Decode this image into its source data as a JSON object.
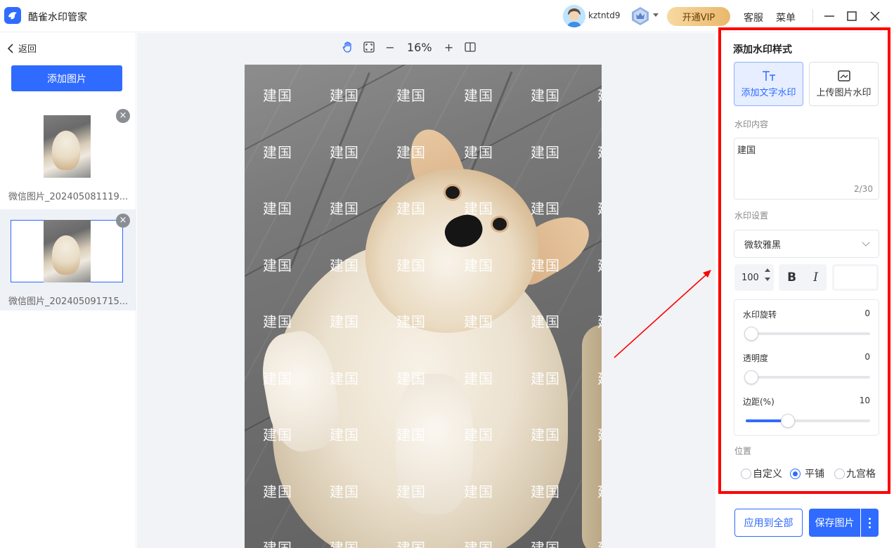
{
  "app": {
    "title": "酷雀水印管家"
  },
  "user": {
    "name": "kztntd9"
  },
  "topbar": {
    "vip_label": "开通VIP",
    "service_label": "客服",
    "menu_label": "菜单"
  },
  "sidebar": {
    "back_label": "返回",
    "add_image_label": "添加图片",
    "images": [
      {
        "name": "微信图片_202405081119...",
        "active": false
      },
      {
        "name": "微信图片_202405091715...",
        "active": true
      }
    ]
  },
  "toolbar": {
    "zoom": "16%",
    "zoom_out": "−",
    "zoom_in": "+"
  },
  "canvas": {
    "watermark_text": "建国"
  },
  "panel": {
    "title": "添加水印样式",
    "text_mode_label": "添加文字水印",
    "image_mode_label": "上传图片水印",
    "content_label": "水印内容",
    "content_value": "建国",
    "content_counter": "2/30",
    "settings_label": "水印设置",
    "font_value": "微软雅黑",
    "font_size": "100",
    "bold_label": "B",
    "italic_label": "I",
    "color": "#ffffff",
    "rotation": {
      "label": "水印旋转",
      "value": "0",
      "fraction": 0
    },
    "opacity": {
      "label": "透明度",
      "value": "0",
      "fraction": 0
    },
    "margin": {
      "label": "边距(%)",
      "value": "10",
      "fraction": 0.295
    },
    "position_label": "位置",
    "position_options": [
      "自定义",
      "平铺",
      "九宫格"
    ],
    "position_selected": "平铺",
    "apply_all_label": "应用到全部",
    "save_label": "保存图片"
  },
  "colors": {
    "accent": "#2f6bff",
    "highlight_box": "#ff0000"
  }
}
